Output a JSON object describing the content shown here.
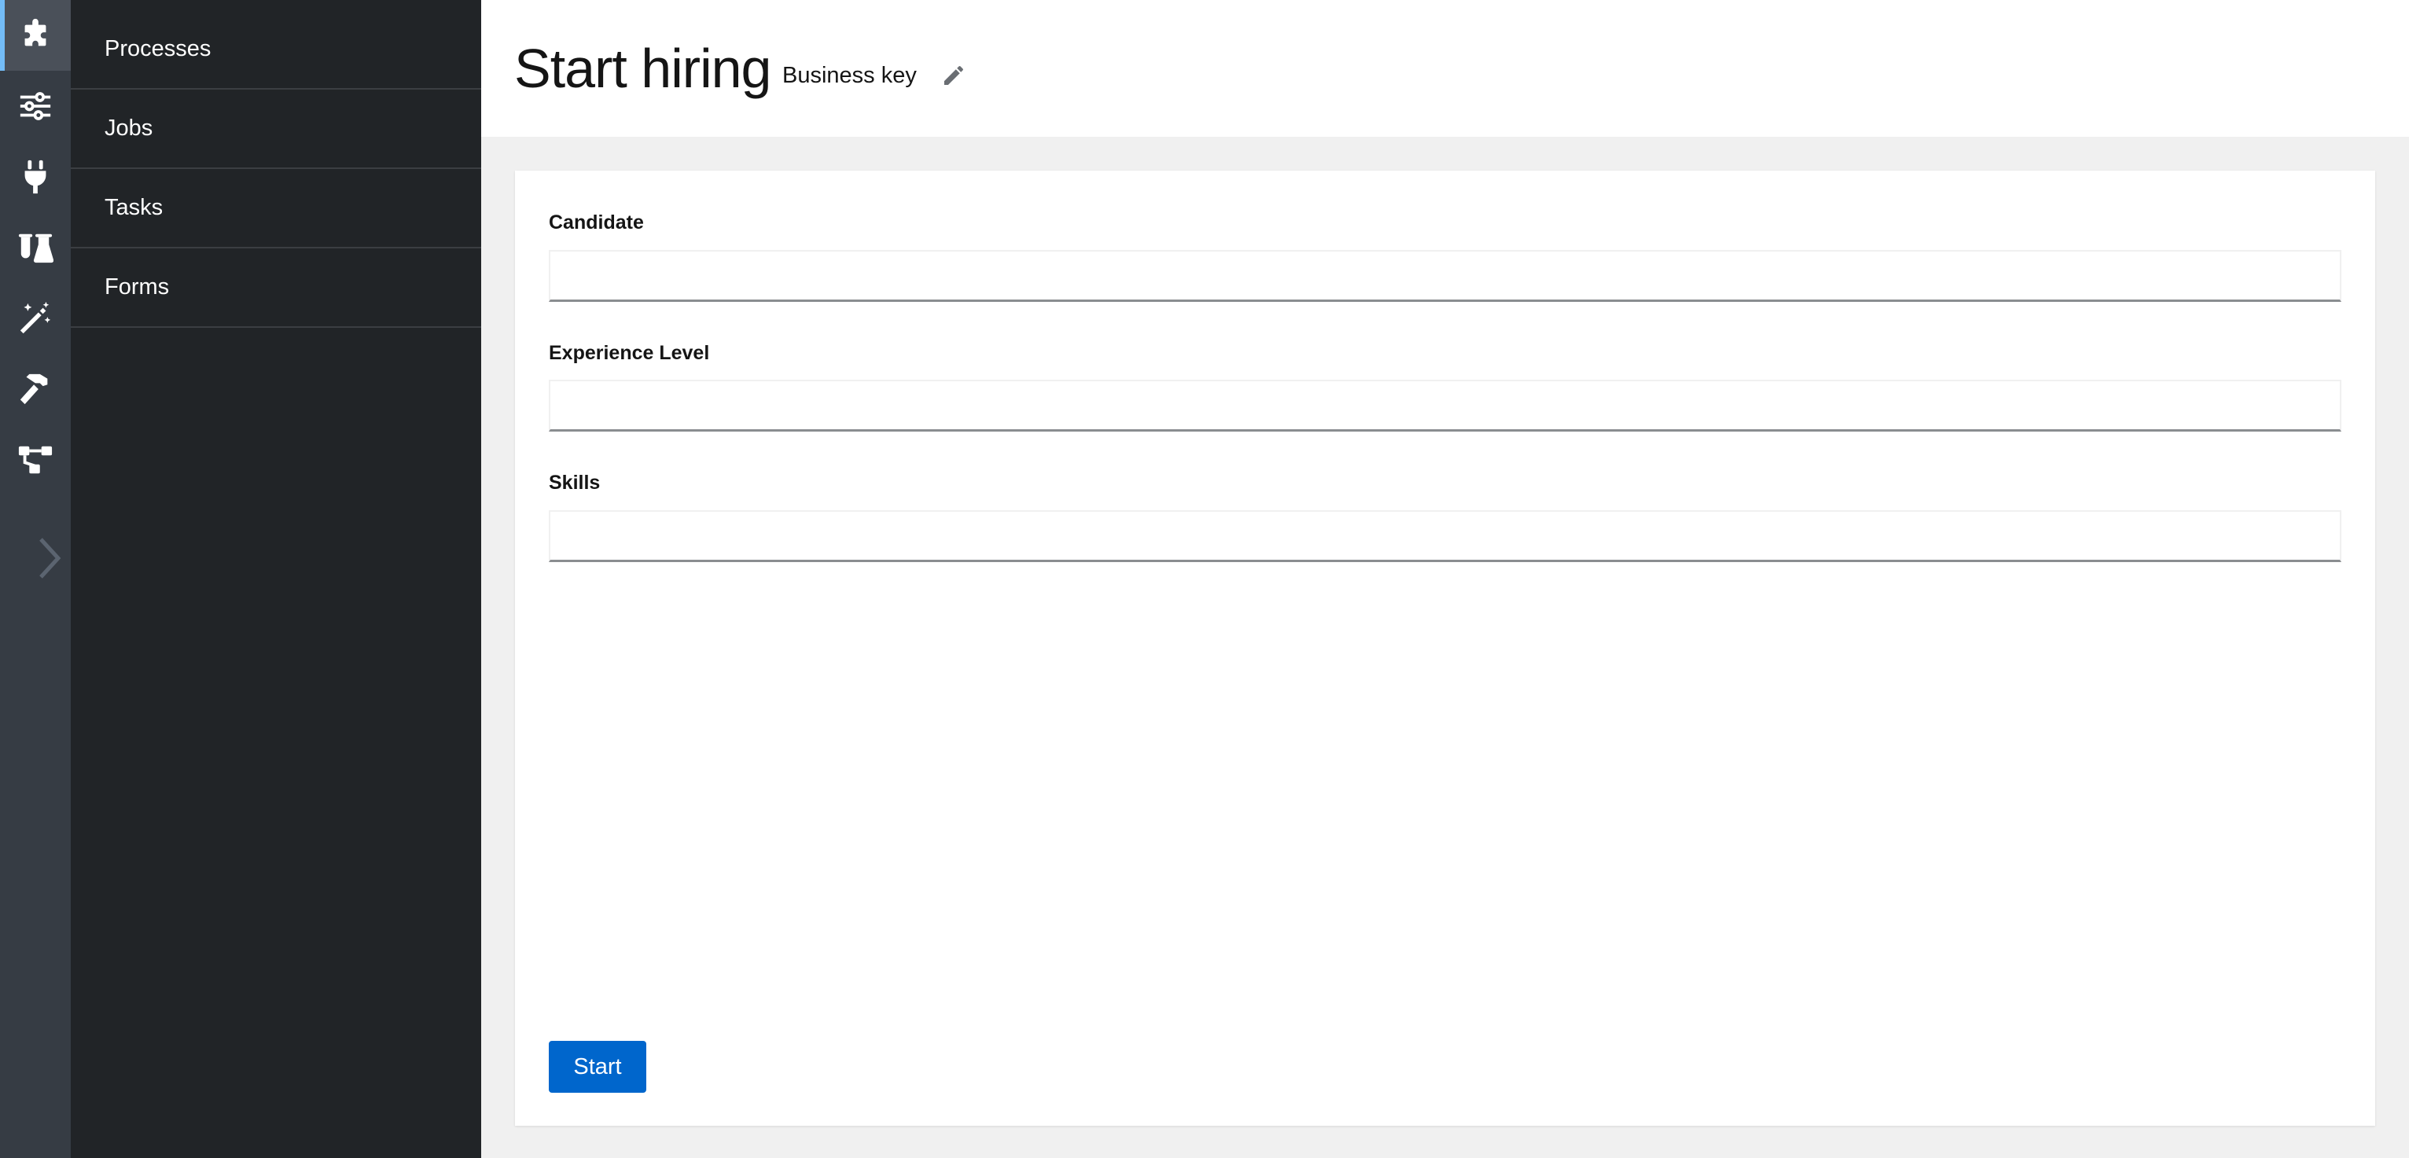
{
  "rail": {
    "items": [
      {
        "icon": "puzzle-piece-icon",
        "active": true
      },
      {
        "icon": "sliders-icon",
        "active": false
      },
      {
        "icon": "plug-icon",
        "active": false
      },
      {
        "icon": "flask-icon",
        "active": false
      },
      {
        "icon": "magic-wand-icon",
        "active": false
      },
      {
        "icon": "hammer-icon",
        "active": false
      },
      {
        "icon": "topology-icon",
        "active": false
      }
    ],
    "expand_icon": "chevron-right-icon"
  },
  "subnav": {
    "items": [
      {
        "label": "Processes"
      },
      {
        "label": "Jobs"
      },
      {
        "label": "Tasks"
      },
      {
        "label": "Forms"
      }
    ]
  },
  "header": {
    "title": "Start hiring",
    "business_key_label": "Business key",
    "edit_icon": "pencil-icon"
  },
  "form": {
    "fields": [
      {
        "label": "Candidate",
        "value": ""
      },
      {
        "label": "Experience Level",
        "value": ""
      },
      {
        "label": "Skills",
        "value": ""
      }
    ],
    "submit_label": "Start"
  },
  "colors": {
    "rail_bg": "#363c44",
    "subnav_bg": "#212427",
    "accent": "#0066cc",
    "active_indicator": "#73bcf7",
    "page_bg": "#f0f0f0"
  }
}
